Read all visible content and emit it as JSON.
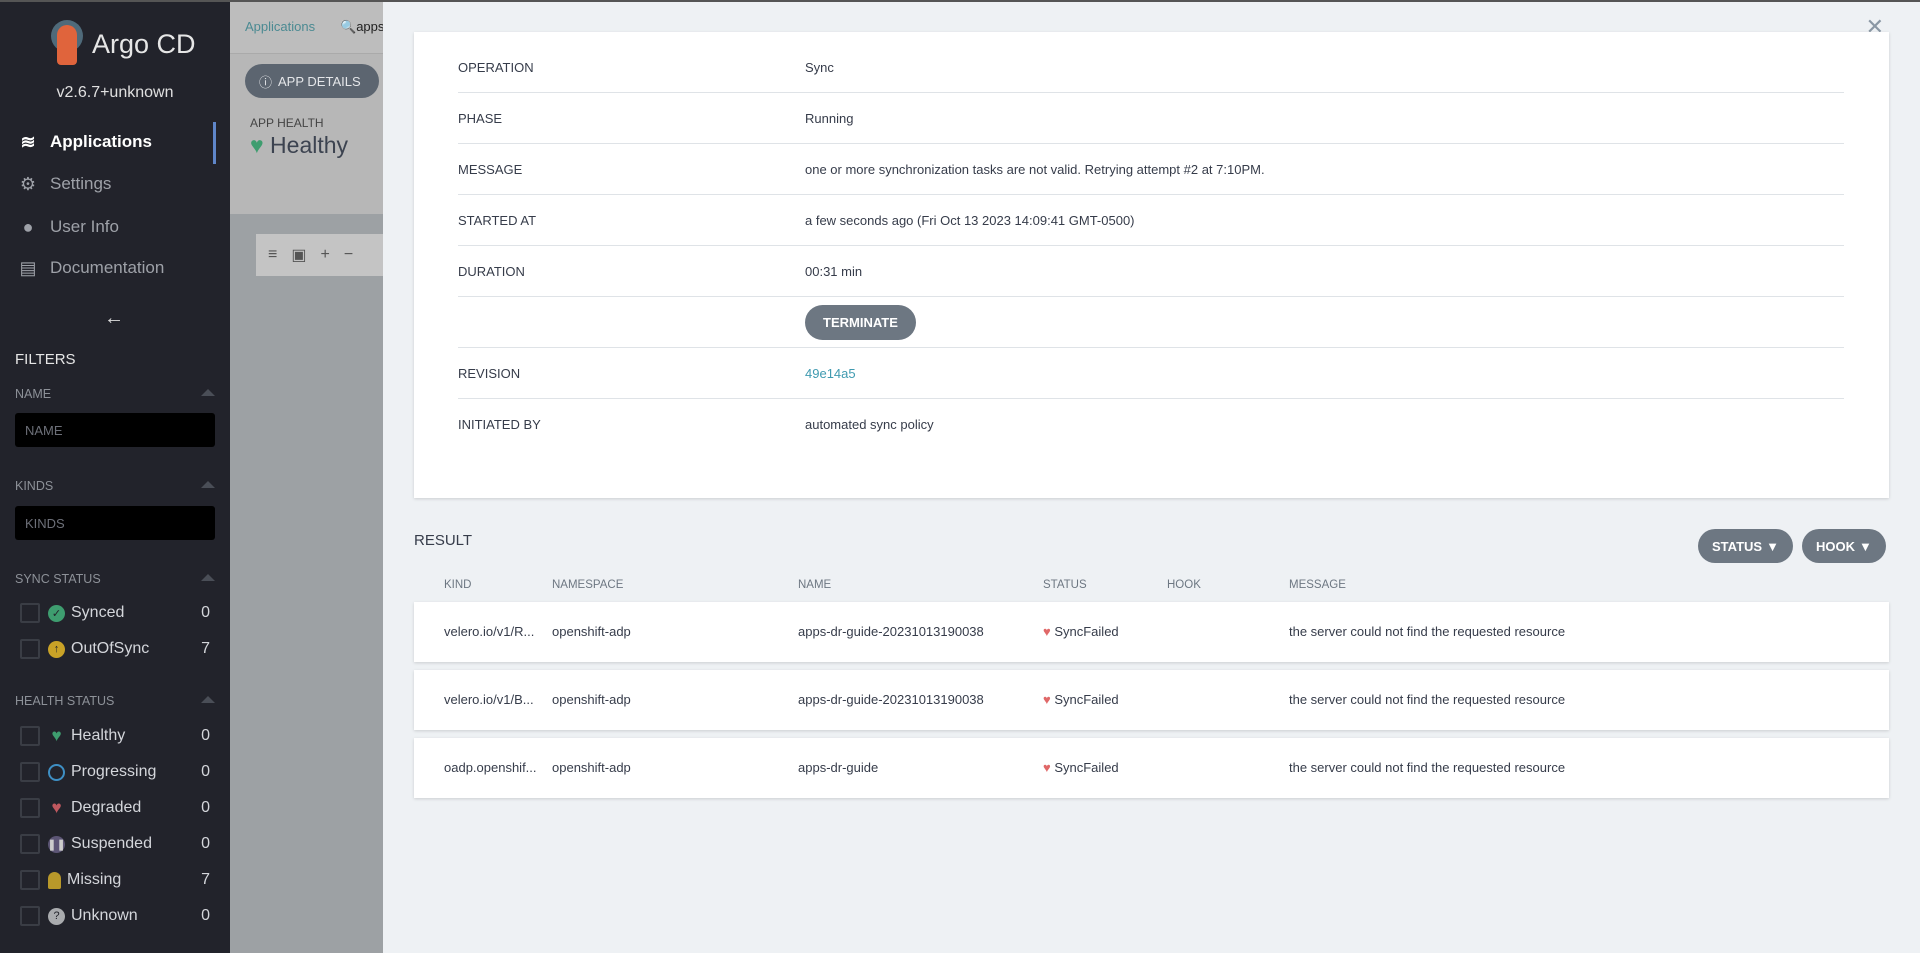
{
  "sidebar": {
    "app_name": "Argo CD",
    "version": "v2.6.7+unknown",
    "nav": [
      {
        "label": "Applications",
        "icon": "layers-icon"
      },
      {
        "label": "Settings",
        "icon": "gears-icon"
      },
      {
        "label": "User Info",
        "icon": "user-icon"
      },
      {
        "label": "Documentation",
        "icon": "book-icon"
      }
    ],
    "filters_title": "FILTERS",
    "name_label": "NAME",
    "name_placeholder": "NAME",
    "kinds_label": "KINDS",
    "kinds_placeholder": "KINDS",
    "sync_label": "SYNC STATUS",
    "sync": [
      {
        "label": "Synced",
        "count": "0",
        "color": "#18be94"
      },
      {
        "label": "OutOfSync",
        "count": "7",
        "color": "#f4c030"
      }
    ],
    "health_label": "HEALTH STATUS",
    "health": [
      {
        "label": "Healthy",
        "count": "0",
        "color": "#18be94"
      },
      {
        "label": "Progressing",
        "count": "0",
        "color": "#0dadea"
      },
      {
        "label": "Degraded",
        "count": "0",
        "color": "#e96d76"
      },
      {
        "label": "Suspended",
        "count": "0",
        "color": "#766f94"
      },
      {
        "label": "Missing",
        "count": "7",
        "color": "#f4c030"
      },
      {
        "label": "Unknown",
        "count": "0",
        "color": "#ccd6dd"
      }
    ]
  },
  "background": {
    "breadcrumb": "Applications",
    "search": "apps",
    "app_details": "APP DETAILS",
    "app_health_label": "APP HEALTH",
    "app_health": "Healthy"
  },
  "operation": {
    "rows": [
      {
        "key": "OPERATION",
        "value": "Sync"
      },
      {
        "key": "PHASE",
        "value": "Running"
      },
      {
        "key": "MESSAGE",
        "value": "one or more synchronization tasks are not valid. Retrying attempt #2 at 7:10PM."
      },
      {
        "key": "STARTED AT",
        "value": "a few seconds ago (Fri Oct 13 2023 14:09:41 GMT-0500)"
      },
      {
        "key": "DURATION",
        "value": "00:31 min"
      }
    ],
    "terminate": "TERMINATE",
    "revision_label": "REVISION",
    "revision": "49e14a5",
    "initiated_label": "INITIATED BY",
    "initiated": "automated sync policy"
  },
  "result": {
    "title": "RESULT",
    "status_filter": "STATUS",
    "hook_filter": "HOOK",
    "columns": [
      "KIND",
      "NAMESPACE",
      "NAME",
      "STATUS",
      "HOOK",
      "MESSAGE"
    ],
    "rows": [
      {
        "kind": "velero.io/v1/R...",
        "namespace": "openshift-adp",
        "name": "apps-dr-guide-20231013190038",
        "status": "SyncFailed",
        "hook": "",
        "message": "the server could not find the requested resource"
      },
      {
        "kind": "velero.io/v1/B...",
        "namespace": "openshift-adp",
        "name": "apps-dr-guide-20231013190038",
        "status": "SyncFailed",
        "hook": "",
        "message": "the server could not find the requested resource"
      },
      {
        "kind": "oadp.openshif...",
        "namespace": "openshift-adp",
        "name": "apps-dr-guide",
        "status": "SyncFailed",
        "hook": "",
        "message": "the server could not find the requested resource"
      }
    ]
  }
}
